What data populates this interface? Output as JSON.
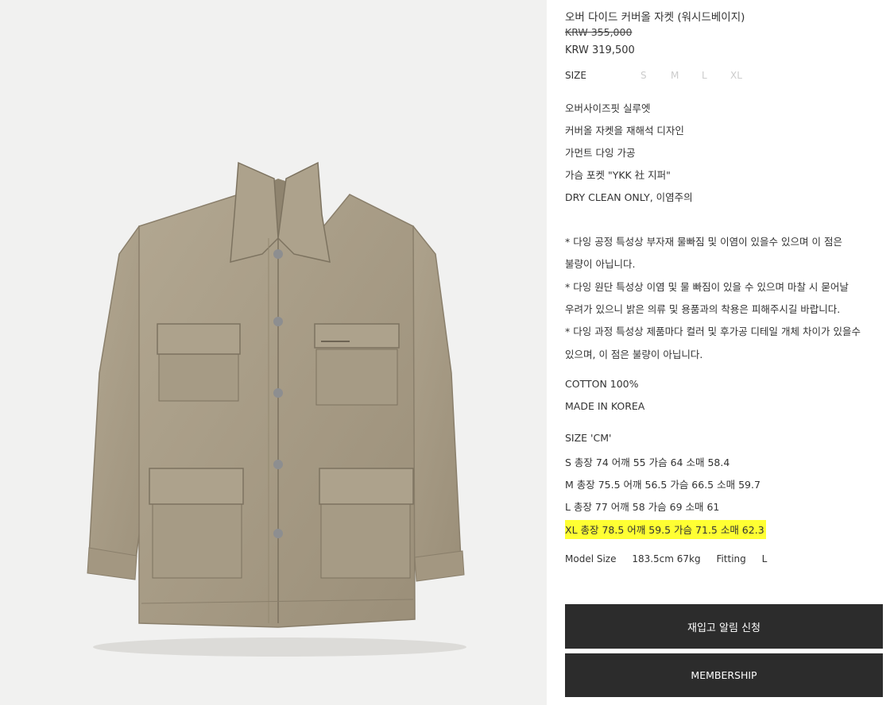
{
  "product": {
    "title": "오버 다이드 커버올 자켓 (워시드베이지)",
    "original_price": "KRW 355,000",
    "sale_price": "KRW 319,500",
    "size_label": "SIZE",
    "sizes": [
      "S",
      "M",
      "L",
      "XL"
    ]
  },
  "features": [
    "오버사이즈핏 실루엣",
    "커버올 자켓을 재해석 디자인",
    "가먼트 다잉 가공",
    "가슴 포켓 \"YKK 社 지퍼\"",
    "DRY CLEAN ONLY, 이염주의"
  ],
  "notes": [
    "* 다잉 공정 특성상 부자재 물빠짐 및 이염이 있을수 있으며 이 점은",
    "불량이 아닙니다.",
    "* 다잉 원단 특성상 이염 및 물 빠짐이 있을 수 있으며 마찰 시 묻어날",
    "우려가 있으니 밝은 의류 및 용품과의 착용은 피해주시길 바랍니다.",
    "* 다잉 과정 특성상 제품마다 컬러 및 후가공 디테일 개체 차이가 있을수",
    "있으며, 이 점은 불량이 아닙니다."
  ],
  "material": {
    "composition": "COTTON 100%",
    "origin": "MADE IN KOREA"
  },
  "size_chart": {
    "header": "SIZE 'CM'",
    "rows": [
      "S 총장 74 어깨 55 가슴 64 소매 58.4",
      "M 총장 75.5 어깨 56.5 가슴 66.5 소매 59.7",
      "L 총장 77 어깨 58 가슴 69 소매 61",
      "XL 총장 78.5 어깨 59.5 가슴 71.5 소매 62.3"
    ]
  },
  "model": {
    "label": "Model Size",
    "measurements": "183.5cm 67kg",
    "fitting_label": "Fitting",
    "fitting_value": "L"
  },
  "buttons": {
    "restock": "재입고 알림 신청",
    "membership": "MEMBERSHIP"
  },
  "colors": {
    "highlight": "#ffff33",
    "button_bg": "#2c2c2c",
    "jacket": "#a89c86"
  },
  "image": {
    "subject": "product-photo-jacket"
  }
}
